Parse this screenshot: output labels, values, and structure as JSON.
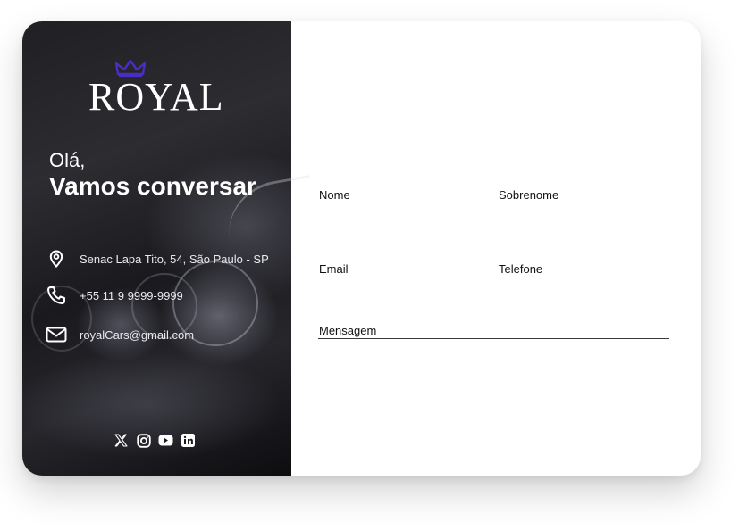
{
  "brand": {
    "name": "ROYAL",
    "crown_color": "#4b2cc4"
  },
  "greeting": {
    "hello": "Olá,",
    "headline": "Vamos conversar"
  },
  "contact": {
    "address": "Senac Lapa Tito, 54, São Paulo - SP",
    "phone": "+55 11 9 9999-9999",
    "email": "royalCars@gmail.com"
  },
  "social": [
    "x-icon",
    "instagram-icon",
    "youtube-icon",
    "linkedin-icon"
  ],
  "form": {
    "first_name_label": "Nome",
    "last_name_label": "Sobrenome",
    "email_label": "Email",
    "phone_label": "Telefone",
    "message_label": "Mensagem"
  }
}
